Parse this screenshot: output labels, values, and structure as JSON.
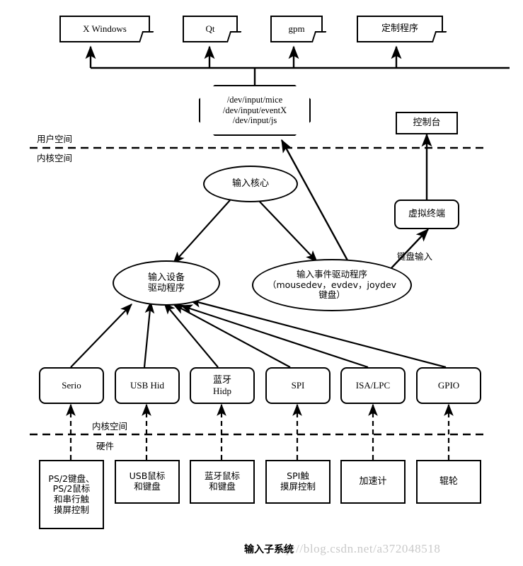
{
  "diagram": {
    "caption": "输入子系统",
    "watermark": "ttp://blog.csdn.net/a372048518",
    "dividers": [
      {
        "above": "用户空间",
        "below": "内核空间"
      },
      {
        "above": "内核空间",
        "below": "硬件"
      }
    ],
    "edge_labels": [
      {
        "name": "keyboard-input",
        "text": "键盘输入"
      }
    ],
    "applications": [
      {
        "id": "x-windows",
        "label": "X Windows"
      },
      {
        "id": "qt",
        "label": "Qt"
      },
      {
        "id": "gpm",
        "label": "gpm"
      },
      {
        "id": "custom-program",
        "label": "定制程序"
      }
    ],
    "device_nodes": {
      "id": "dev-input-nodes",
      "lines": [
        "/dev/input/mice",
        "/dev/input/eventX",
        "/dev/input/js"
      ]
    },
    "console": {
      "id": "console",
      "label": "控制台"
    },
    "virtual_terminal": {
      "id": "virtual-terminal",
      "label": "虚拟终端"
    },
    "input_core": {
      "id": "input-core",
      "label": "输入核心"
    },
    "input_device_driver": {
      "id": "input-device-driver",
      "lines": [
        "输入设备",
        "驱动程序"
      ]
    },
    "input_event_driver": {
      "id": "input-event-driver",
      "lines": [
        "输入事件驱动程序",
        "（mousedev，evdev，joydev",
        "键盘）"
      ]
    },
    "bus_layer": [
      {
        "id": "serio",
        "label": "Serio"
      },
      {
        "id": "usb-hid",
        "label": "USB Hid"
      },
      {
        "id": "bluetooth-hidp",
        "lines": [
          "蓝牙",
          "Hidp"
        ]
      },
      {
        "id": "spi",
        "label": "SPI"
      },
      {
        "id": "isa-lpc",
        "label": "ISA/LPC"
      },
      {
        "id": "gpio",
        "label": "GPIO"
      }
    ],
    "hardware_layer": [
      {
        "id": "ps2-devices",
        "lines": [
          "PS/2键盘、",
          "PS/2鼠标",
          "和串行触",
          "摸屏控制"
        ]
      },
      {
        "id": "usb-devices",
        "lines": [
          "USB鼠标",
          "和键盘"
        ]
      },
      {
        "id": "bluetooth-devices",
        "lines": [
          "蓝牙鼠标",
          "和键盘"
        ]
      },
      {
        "id": "spi-touch",
        "lines": [
          "SPI触",
          "摸屏控制"
        ]
      },
      {
        "id": "accelerometer",
        "label": "加速计"
      },
      {
        "id": "roller",
        "label": "辊轮"
      }
    ]
  }
}
